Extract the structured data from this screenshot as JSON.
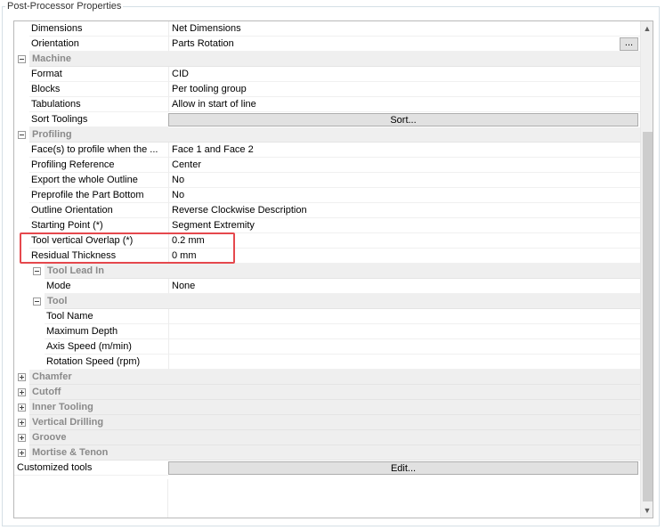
{
  "panel": {
    "title": "Post-Processor Properties"
  },
  "rows": {
    "dimensions": {
      "name": "Dimensions",
      "value": "Net Dimensions"
    },
    "orientation": {
      "name": "Orientation",
      "value": "Parts Rotation",
      "button": "..."
    },
    "machine": {
      "name": "Machine"
    },
    "format": {
      "name": "Format",
      "value": "CID"
    },
    "blocks": {
      "name": "Blocks",
      "value": "Per tooling group"
    },
    "tabulations": {
      "name": "Tabulations",
      "value": "Allow in start of line"
    },
    "sort_toolings": {
      "name": "Sort Toolings",
      "button": "Sort..."
    },
    "profiling": {
      "name": "Profiling"
    },
    "faces": {
      "name": "Face(s) to profile when the ...",
      "value": "Face 1 and Face 2"
    },
    "profiling_reference": {
      "name": "Profiling Reference",
      "value": "Center"
    },
    "export_outline": {
      "name": "Export the whole Outline",
      "value": "No"
    },
    "preprofile": {
      "name": "Preprofile the Part Bottom",
      "value": "No"
    },
    "outline_orientation": {
      "name": "Outline Orientation",
      "value": "Reverse Clockwise Description"
    },
    "starting_point": {
      "name": "Starting Point (*)",
      "value": "Segment Extremity"
    },
    "tool_vertical_overlap": {
      "name": "Tool vertical Overlap (*)",
      "value": "0.2 mm"
    },
    "residual_thickness": {
      "name": "Residual Thickness",
      "value": "0 mm"
    },
    "tool_lead_in": {
      "name": "Tool Lead In"
    },
    "mode": {
      "name": "Mode",
      "value": "None"
    },
    "tool": {
      "name": "Tool"
    },
    "tool_name": {
      "name": "Tool Name",
      "value": ""
    },
    "maximum_depth": {
      "name": "Maximum Depth",
      "value": ""
    },
    "axis_speed": {
      "name": "Axis Speed (m/min)",
      "value": ""
    },
    "rotation_speed": {
      "name": "Rotation Speed (rpm)",
      "value": ""
    },
    "chamfer": {
      "name": "Chamfer"
    },
    "cutoff": {
      "name": "Cutoff"
    },
    "inner_tooling": {
      "name": "Inner Tooling"
    },
    "vertical_drilling": {
      "name": "Vertical Drilling"
    },
    "groove": {
      "name": "Groove"
    },
    "mortise_tenon": {
      "name": "Mortise & Tenon"
    },
    "customized_tools": {
      "name": "Customized tools",
      "button": "Edit..."
    }
  },
  "scrollbar": {
    "up_arrow": "▲",
    "down_arrow": "▼"
  },
  "colors": {
    "highlight": "#e5484d",
    "category_bg": "#efefef",
    "category_text": "#8a8a8a"
  }
}
